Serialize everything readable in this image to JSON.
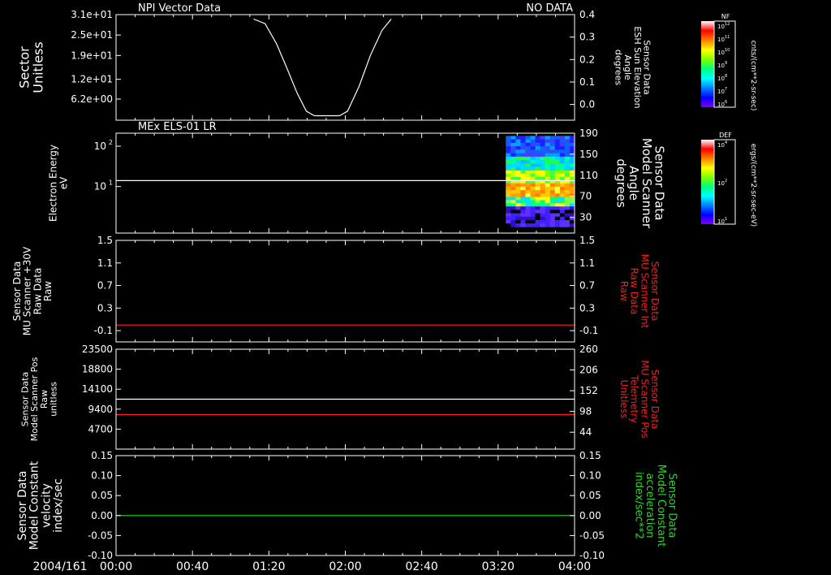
{
  "palette": {
    "background": "#000000",
    "axis": "#ffffff",
    "red_series": "#ff1a1a",
    "green_series": "#22dd22",
    "white_series": "#ffffff"
  },
  "time_axis": {
    "date": "2004/161",
    "ticks": [
      "00:00",
      "00:40",
      "01:20",
      "02:00",
      "02:40",
      "03:20",
      "04:00"
    ],
    "range_hours": [
      0,
      4
    ]
  },
  "colorbars": [
    {
      "corner_label": "NF",
      "unit_label": "cnts/(cm**2-sr-sec)",
      "tick_labels": [
        "10^12",
        "10^11",
        "10^10",
        "10^9",
        "10^8",
        "10^7",
        "10^6"
      ]
    },
    {
      "corner_label": "DEF",
      "unit_label": "ergs/(cm**2-sr-sec-eV)",
      "tick_labels": [
        "10^4",
        "10^2",
        "10^1"
      ]
    }
  ],
  "chart_data": [
    {
      "type": "line",
      "title": "NPI Vector Data",
      "status": "NO DATA",
      "left_axis": {
        "label_lines": [
          "Sector",
          "Unitless"
        ],
        "ticks": [
          "3.1e+01",
          "2.5e+01",
          "1.9e+01",
          "1.2e+01",
          "6.2e+00"
        ],
        "tick_values": [
          31,
          25,
          19,
          12,
          6.2
        ],
        "range": [
          0,
          31
        ]
      },
      "right_axis": {
        "label_lines": [
          "Sensor Data",
          "ESH Sun Elevation",
          "Angle",
          "degrees"
        ],
        "ticks": [
          "0.4",
          "0.3",
          "0.2",
          "0.1",
          "0.0"
        ],
        "tick_values": [
          0.4,
          0.3,
          0.2,
          0.1,
          0.0
        ],
        "range": [
          -0.07,
          0.4
        ]
      },
      "series": [
        {
          "color": "#ffffff",
          "axis": "right",
          "x_hours": [
            1.2,
            1.3,
            1.4,
            1.5,
            1.58,
            1.66,
            1.73,
            1.95,
            2.02,
            2.12,
            2.22,
            2.32,
            2.4
          ],
          "y": [
            0.38,
            0.36,
            0.27,
            0.15,
            0.05,
            -0.03,
            -0.05,
            -0.05,
            -0.03,
            0.08,
            0.22,
            0.33,
            0.38
          ]
        }
      ]
    },
    {
      "type": "heatmap",
      "title": "MEx ELS-01 LR",
      "left_axis": {
        "label_lines": [
          "Electron Energy",
          "eV"
        ],
        "scale": "log",
        "ticks": [
          "10^2",
          "10^1"
        ],
        "tick_values": [
          100,
          10
        ],
        "range": [
          0.7,
          210
        ]
      },
      "right_axis": {
        "label_lines": [
          "Sensor Data",
          "Model Scanner",
          "Angle",
          "degrees"
        ],
        "ticks": [
          "190",
          "150",
          "110",
          "70",
          "30"
        ],
        "tick_values": [
          190,
          150,
          110,
          70,
          30
        ],
        "range": [
          0,
          190
        ]
      },
      "series": [
        {
          "color": "#ffffff",
          "axis": "left",
          "x_hours": [
            0,
            4
          ],
          "y": [
            14,
            14
          ]
        }
      ],
      "heatmap": {
        "x_range_hours": [
          3.4,
          4.0
        ],
        "energy_range_ev": [
          1.0,
          180
        ],
        "bands": [
          {
            "energy_ev": [
              55,
              180
            ],
            "colors": [
              "#2020ff",
              "#1060ff",
              "#00a0ff",
              "#4040ff"
            ]
          },
          {
            "energy_ev": [
              25,
              55
            ],
            "colors": [
              "#00d8ff",
              "#00ffa0",
              "#20ff40",
              "#00c0ff"
            ]
          },
          {
            "energy_ev": [
              12,
              25
            ],
            "colors": [
              "#80ff00",
              "#ffff00",
              "#d0ff00",
              "#40ff40"
            ]
          },
          {
            "energy_ev": [
              5.5,
              12
            ],
            "colors": [
              "#ffa000",
              "#ffc800",
              "#ff8000",
              "#ffff40"
            ]
          },
          {
            "energy_ev": [
              3.2,
              5.5
            ],
            "colors": [
              "#ffff00",
              "#80ff40",
              "#00ff80",
              "#00e0ff"
            ]
          },
          {
            "energy_ev": [
              1.0,
              3.2
            ],
            "colors": [
              "#4020ff",
              "#6030ff",
              "#000000",
              "#3010c0"
            ]
          }
        ]
      }
    },
    {
      "type": "line",
      "left_axis": {
        "label_lines": [
          "Sensor Data",
          "MU Scanner +30V",
          "Raw Data",
          "Raw"
        ],
        "ticks": [
          "1.5",
          "1.1",
          "0.7",
          "0.3",
          "-0.1"
        ],
        "tick_values": [
          1.5,
          1.1,
          0.7,
          0.3,
          -0.1
        ],
        "range": [
          -0.3,
          1.5
        ]
      },
      "right_axis": {
        "label_lines": [
          "Sensor Data",
          "MU Scanner Int",
          "Raw Data",
          "Raw"
        ],
        "ticks": [
          "1.5",
          "1.1",
          "0.7",
          "0.3",
          "-0.1"
        ],
        "tick_values": [
          1.5,
          1.1,
          0.7,
          0.3,
          -0.1
        ],
        "range": [
          -0.3,
          1.5
        ],
        "label_color": "#ff1a1a"
      },
      "series": [
        {
          "color": "#ff1a1a",
          "axis": "right",
          "x_hours": [
            0,
            4
          ],
          "y": [
            0.0,
            0.0
          ]
        }
      ]
    },
    {
      "type": "line",
      "left_axis": {
        "label_lines": [
          "Sensor Data",
          "Model Scanner Pos",
          "Raw",
          "unitless"
        ],
        "ticks": [
          "23500",
          "18800",
          "14100",
          "9400",
          "4700"
        ],
        "tick_values": [
          23500,
          18800,
          14100,
          9400,
          4700
        ],
        "range": [
          0,
          23500
        ]
      },
      "right_axis": {
        "label_lines": [
          "Sensor Data",
          "MU Scanner Pos",
          "Telemetry",
          "Unitless"
        ],
        "ticks": [
          "260",
          "206",
          "152",
          "98",
          "44"
        ],
        "tick_values": [
          260,
          206,
          152,
          98,
          44
        ],
        "range": [
          0,
          260
        ],
        "label_color": "#ff1a1a"
      },
      "series": [
        {
          "color": "#ffffff",
          "axis": "left",
          "x_hours": [
            0,
            4
          ],
          "y": [
            11750,
            11750
          ]
        },
        {
          "color": "#ff1a1a",
          "axis": "right",
          "x_hours": [
            0,
            4
          ],
          "y": [
            90,
            90
          ]
        }
      ]
    },
    {
      "type": "line",
      "left_axis": {
        "label_lines": [
          "Sensor Data",
          "Model Constant",
          "velocity",
          "index/sec"
        ],
        "ticks": [
          "0.15",
          "0.10",
          "0.05",
          "0.00",
          "-0.05",
          "-0.10"
        ],
        "tick_values": [
          0.15,
          0.1,
          0.05,
          0.0,
          -0.05,
          -0.1
        ],
        "range": [
          -0.1,
          0.15
        ]
      },
      "right_axis": {
        "label_lines": [
          "Sensor Data",
          "Model Constant",
          "acceleration",
          "index/sec**2"
        ],
        "ticks": [
          "0.15",
          "0.10",
          "0.05",
          "0.00",
          "-0.05",
          "-0.10"
        ],
        "tick_values": [
          0.15,
          0.1,
          0.05,
          0.0,
          -0.05,
          -0.1
        ],
        "range": [
          -0.1,
          0.15
        ],
        "label_color": "#22dd22"
      },
      "series": [
        {
          "color": "#22dd22",
          "axis": "left",
          "x_hours": [
            0,
            4
          ],
          "y": [
            0.0,
            0.0
          ]
        }
      ]
    }
  ]
}
